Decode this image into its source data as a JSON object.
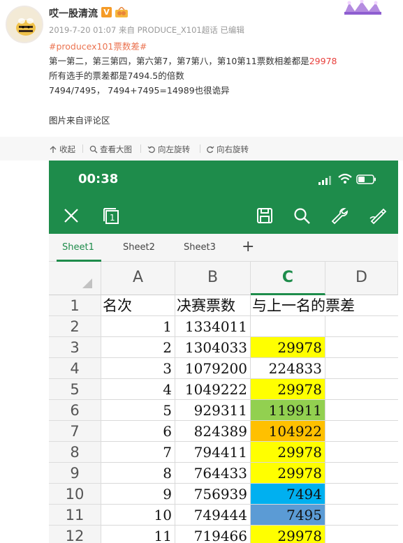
{
  "post": {
    "username": "哎一股清流",
    "verified_badge": "V",
    "meta": "2019-7-20 01:07 来自 PRODUCE_X101超话  已编辑",
    "hashtag": "#producex101票数差#",
    "line1_text": "第一第二，第三第四，第六第7，第7第八，第10第11票数相差都是",
    "line1_number": "29978",
    "line2": "所有选手的票差都是7494.5的倍数",
    "line3": "7494/7495，  7494+7495=14989也很诡异",
    "line4": "图片来自评论区"
  },
  "actions": [
    {
      "label": "收起",
      "icon": "collapse-icon"
    },
    {
      "label": "查看大图",
      "icon": "zoom-icon"
    },
    {
      "label": "向左旋转",
      "icon": "rotate-left-icon"
    },
    {
      "label": "向右旋转",
      "icon": "rotate-right-icon"
    }
  ],
  "phone": {
    "time": "00:38",
    "toolbar_icons": [
      "close-icon",
      "windows-icon",
      "save-icon",
      "search-icon",
      "wrench-icon",
      "pen-icon"
    ],
    "sheet_tabs": [
      "Sheet1",
      "Sheet2",
      "Sheet3"
    ],
    "active_sheet": "Sheet1",
    "columns": [
      "A",
      "B",
      "C",
      "D"
    ],
    "selected_column": "C",
    "header_row": {
      "row": "1",
      "a": "名次",
      "b": "决赛票数",
      "c": "与上一名的票差"
    },
    "rows": [
      {
        "row": "2",
        "rank": "1",
        "votes": "1334011",
        "diff": ""
      },
      {
        "row": "3",
        "rank": "2",
        "votes": "1304033",
        "diff": "29978"
      },
      {
        "row": "4",
        "rank": "3",
        "votes": "1079200",
        "diff": "224833"
      },
      {
        "row": "5",
        "rank": "4",
        "votes": "1049222",
        "diff": "29978"
      },
      {
        "row": "6",
        "rank": "5",
        "votes": "929311",
        "diff": "119911"
      },
      {
        "row": "7",
        "rank": "6",
        "votes": "824389",
        "diff": "104922"
      },
      {
        "row": "8",
        "rank": "7",
        "votes": "794411",
        "diff": "29978"
      },
      {
        "row": "9",
        "rank": "8",
        "votes": "764433",
        "diff": "29978"
      },
      {
        "row": "10",
        "rank": "9",
        "votes": "756939",
        "diff": "7494"
      },
      {
        "row": "11",
        "rank": "10",
        "votes": "749444",
        "diff": "7495"
      },
      {
        "row": "12",
        "rank": "11",
        "votes": "719466",
        "diff": "29978"
      }
    ],
    "highlight_colors": {
      "yellow": "#ffff00",
      "green": "#92d050",
      "orange": "#ffc000",
      "blue": "#00b0f0",
      "steel_blue": "#5b9bd5",
      "brand_green": "#1e8c4b"
    },
    "diff_highlight": [
      "none",
      "yellow",
      "none",
      "yellow",
      "green",
      "orange",
      "yellow",
      "yellow",
      "blue",
      "steel_blue",
      "yellow"
    ]
  }
}
